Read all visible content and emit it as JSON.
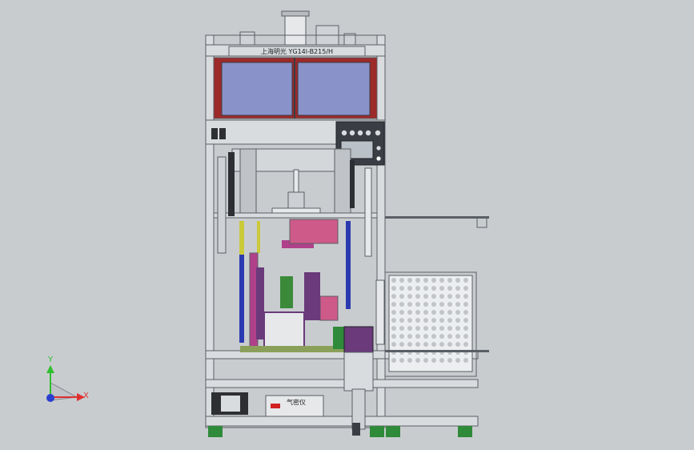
{
  "machine": {
    "title_plate": "上海明光  YG14l-B215/H",
    "gauge_label": "气密仪"
  },
  "triad": {
    "y_label": "Y",
    "x_label": "X"
  },
  "colors": {
    "background": "#c9cccf",
    "frame": "#d9dcdf",
    "frame_edge": "#5a5f66",
    "window_red": "#9c2a2a",
    "window_glass": "#8a93c9",
    "hmi": "#3a3d44",
    "axis_y": "#2fbf2f",
    "axis_x": "#e03030",
    "axis_z": "#2a3fd0",
    "magenta_parts": "#b0408a",
    "purple_parts": "#6a3a7a",
    "blue_rod": "#2a3ab0",
    "yellow_rod": "#c9c93a",
    "caster_green": "#2f8a3a"
  },
  "icons": {
    "triad": "coordinate-triad-icon"
  }
}
